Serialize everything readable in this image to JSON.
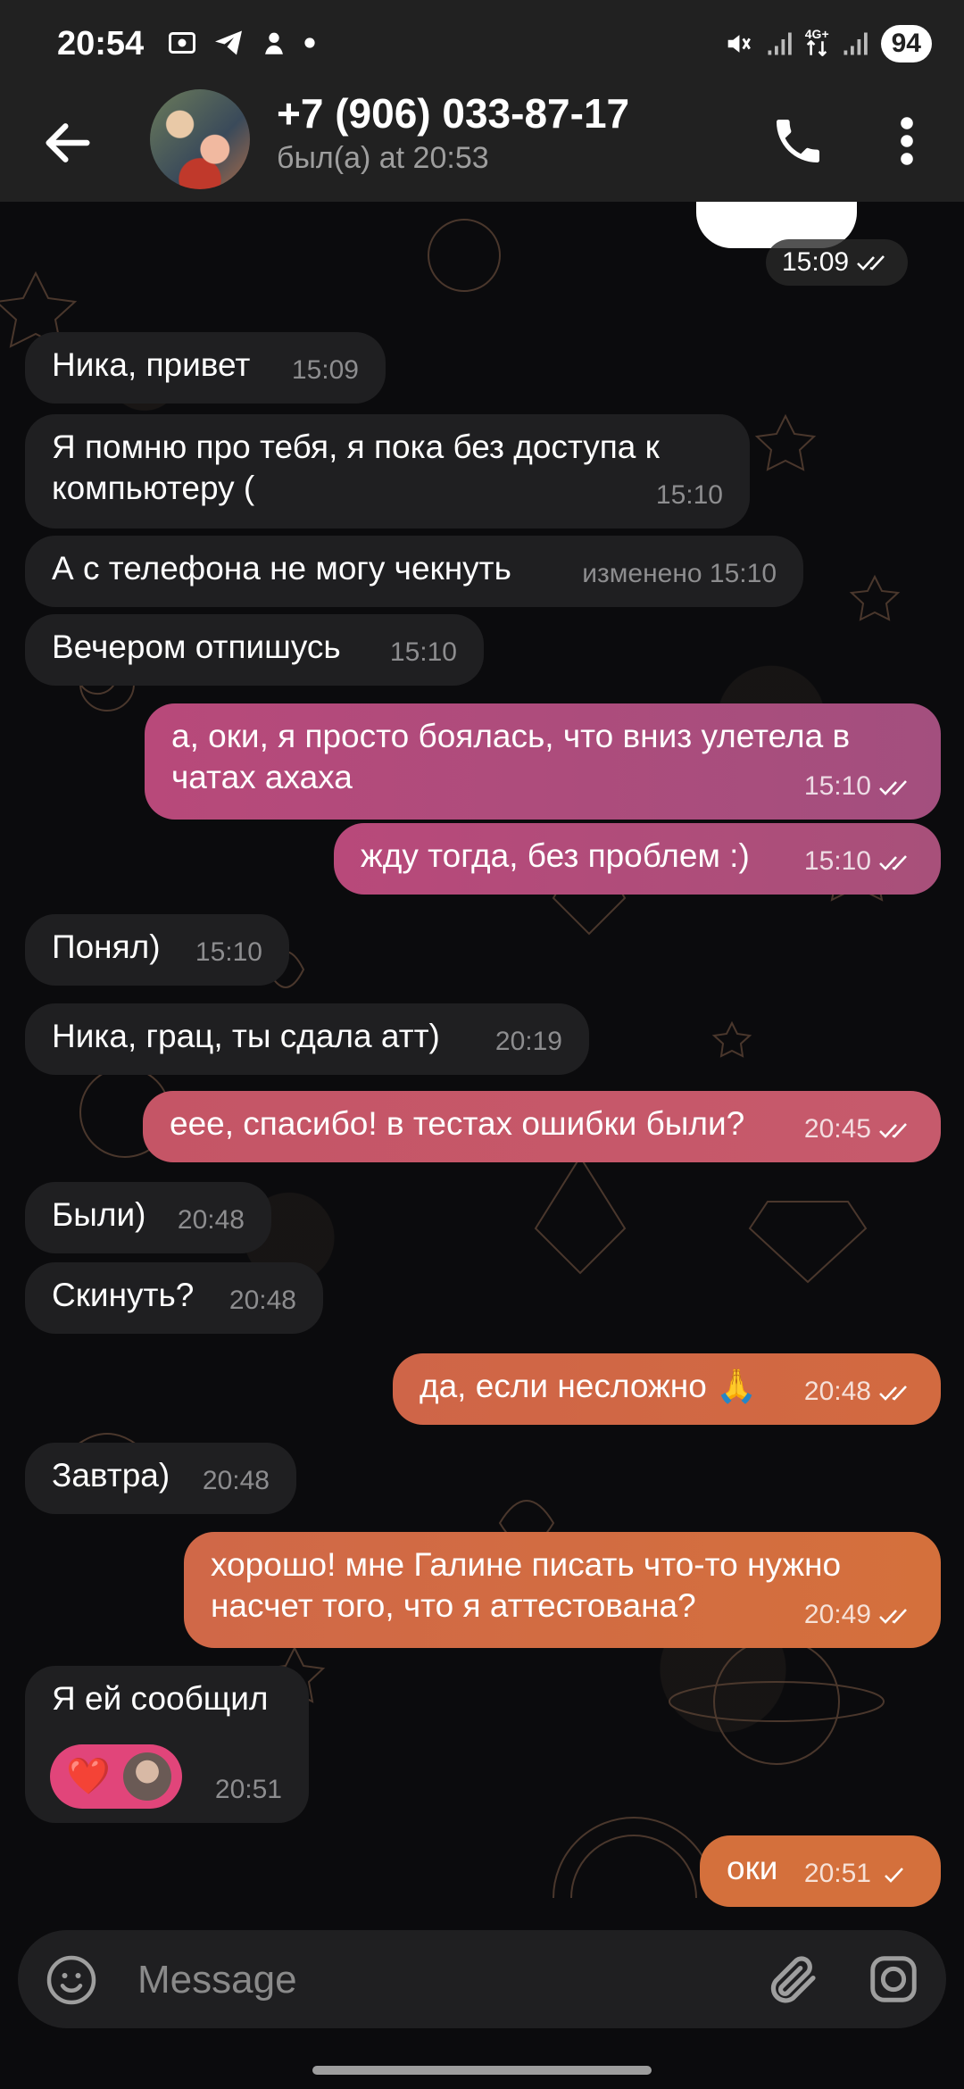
{
  "status_bar": {
    "time": "20:54",
    "net_label_top": "4G+",
    "battery": "94"
  },
  "header": {
    "contact_name": "+7 (906) 033-87-17",
    "last_seen": "был(а) at 20:53"
  },
  "messages": [
    {
      "dir": "out",
      "text": "",
      "time": "15:09"
    },
    {
      "dir": "in",
      "text": "Ника, привет",
      "time": "15:09"
    },
    {
      "dir": "in",
      "text": "Я помню про тебя, я пока без доступа к компьютеру (",
      "time": "15:10"
    },
    {
      "dir": "in",
      "text": "А с телефона не могу чекнуть",
      "time": "изменено 15:10"
    },
    {
      "dir": "in",
      "text": "Вечером отпишусь",
      "time": "15:10"
    },
    {
      "dir": "out",
      "text": "а, оки, я просто боялась, что вниз улетела в чатах ахаха",
      "time": "15:10"
    },
    {
      "dir": "out",
      "text": "жду тогда, без проблем :)",
      "time": "15:10"
    },
    {
      "dir": "in",
      "text": "Понял)",
      "time": "15:10"
    },
    {
      "dir": "in",
      "text": "Ника, грац, ты сдала атт)",
      "time": "20:19"
    },
    {
      "dir": "out",
      "text": "еее, спасибо! в тестах ошибки были?",
      "time": "20:45"
    },
    {
      "dir": "in",
      "text": "Были)",
      "time": "20:48"
    },
    {
      "dir": "in",
      "text": "Скинуть?",
      "time": "20:48"
    },
    {
      "dir": "out",
      "text": "да, если несложно 🙏",
      "time": "20:48"
    },
    {
      "dir": "in",
      "text": "Завтра)",
      "time": "20:48"
    },
    {
      "dir": "out",
      "text": "хорошо! мне Галине писать что-то нужно насчет того, что я аттестована?",
      "time": "20:49"
    },
    {
      "dir": "in",
      "text": "Я ей сообщил",
      "time": "20:51",
      "reaction": "❤️"
    },
    {
      "dir": "out",
      "text": "оки",
      "time": "20:51"
    }
  ],
  "composer": {
    "placeholder": "Message"
  },
  "colors": {
    "incoming": "#1f1f21",
    "out_purple": "#a8507a",
    "out_pink": "#c65a6c",
    "out_orange": "#d4703c"
  }
}
